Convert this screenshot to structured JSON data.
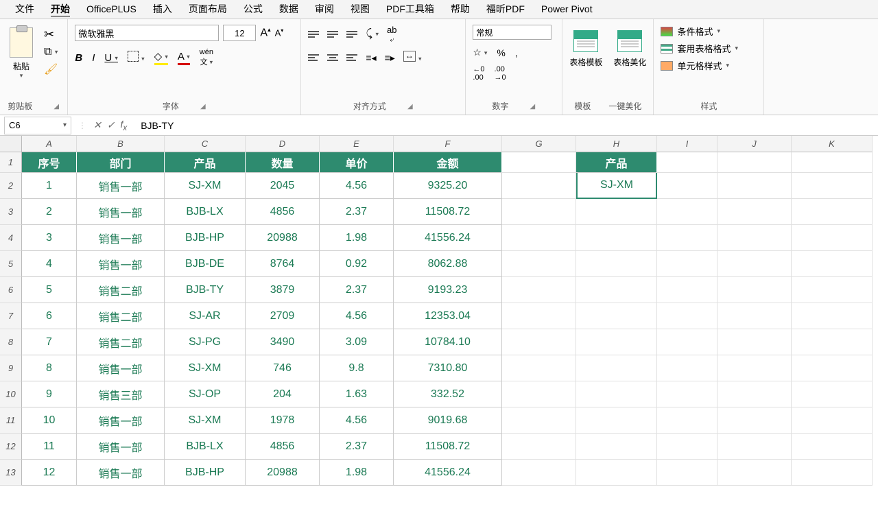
{
  "menubar": [
    "文件",
    "开始",
    "OfficePLUS",
    "插入",
    "页面布局",
    "公式",
    "数据",
    "审阅",
    "视图",
    "PDF工具箱",
    "帮助",
    "福昕PDF",
    "Power Pivot"
  ],
  "active_tab": 1,
  "ribbon": {
    "clipboard": {
      "paste": "粘贴",
      "label": "剪贴板"
    },
    "font": {
      "name": "微软雅黑",
      "size": "12",
      "label": "字体"
    },
    "align": {
      "label": "对齐方式"
    },
    "number": {
      "format": "常规",
      "label": "数字"
    },
    "template": {
      "btn1": "表格模板",
      "btn2": "表格美化",
      "label1": "模板",
      "label2": "一键美化"
    },
    "styles": {
      "cond": "条件格式",
      "table": "套用表格格式",
      "cell": "单元格样式",
      "label": "样式"
    }
  },
  "formula_bar": {
    "name_box": "C6",
    "value": "BJB-TY"
  },
  "col_headers": [
    "A",
    "B",
    "C",
    "D",
    "E",
    "F",
    "G",
    "H",
    "I",
    "J",
    "K"
  ],
  "row_headers": [
    "1",
    "2",
    "3",
    "4",
    "5",
    "6",
    "7",
    "8",
    "9",
    "10",
    "11",
    "12",
    "13"
  ],
  "table_headers": [
    "序号",
    "部门",
    "产品",
    "数量",
    "单价",
    "金额"
  ],
  "h_header": "产品",
  "h_value": "SJ-XM",
  "data": [
    [
      "1",
      "销售一部",
      "SJ-XM",
      "2045",
      "4.56",
      "9325.20"
    ],
    [
      "2",
      "销售一部",
      "BJB-LX",
      "4856",
      "2.37",
      "11508.72"
    ],
    [
      "3",
      "销售一部",
      "BJB-HP",
      "20988",
      "1.98",
      "41556.24"
    ],
    [
      "4",
      "销售一部",
      "BJB-DE",
      "8764",
      "0.92",
      "8062.88"
    ],
    [
      "5",
      "销售二部",
      "BJB-TY",
      "3879",
      "2.37",
      "9193.23"
    ],
    [
      "6",
      "销售二部",
      "SJ-AR",
      "2709",
      "4.56",
      "12353.04"
    ],
    [
      "7",
      "销售二部",
      "SJ-PG",
      "3490",
      "3.09",
      "10784.10"
    ],
    [
      "8",
      "销售一部",
      "SJ-XM",
      "746",
      "9.8",
      "7310.80"
    ],
    [
      "9",
      "销售三部",
      "SJ-OP",
      "204",
      "1.63",
      "332.52"
    ],
    [
      "10",
      "销售一部",
      "SJ-XM",
      "1978",
      "4.56",
      "9019.68"
    ],
    [
      "11",
      "销售一部",
      "BJB-LX",
      "4856",
      "2.37",
      "11508.72"
    ],
    [
      "12",
      "销售一部",
      "BJB-HP",
      "20988",
      "1.98",
      "41556.24"
    ]
  ]
}
